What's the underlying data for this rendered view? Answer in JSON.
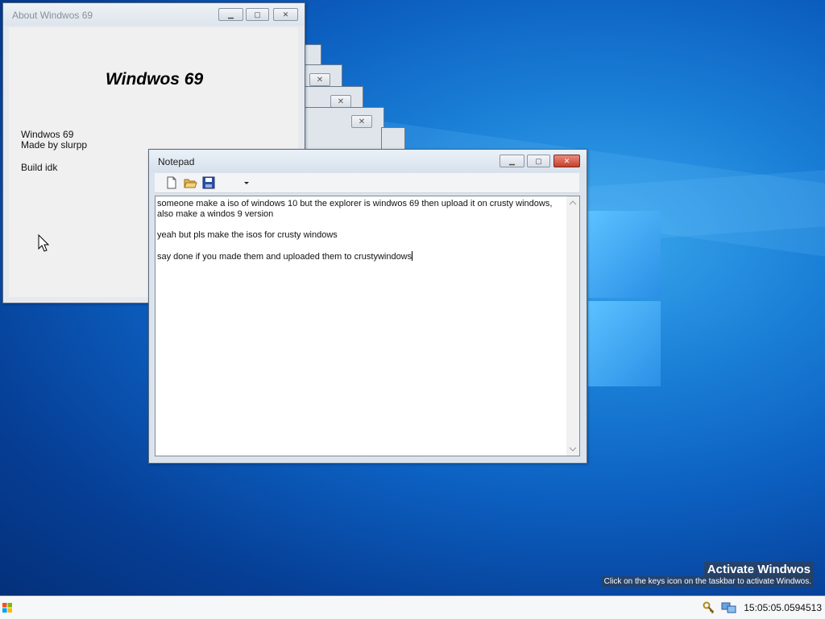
{
  "about_window": {
    "title": "About Windwos 69",
    "heading": "Windwos 69",
    "lines": [
      "Windwos 69",
      "Made by slurpp",
      "Build idk"
    ]
  },
  "notepad": {
    "title": "Notepad",
    "paragraphs": [
      "someone make a iso of windows 10 but the explorer is windwos 69 then upload it on crusty windows, also make a windos 9 version",
      "yeah but pls make the isos for crusty windows",
      "say done if you made them and uploaded them to crustywindows"
    ],
    "toolbar": [
      "new-file-icon",
      "open-folder-icon",
      "save-icon",
      "dropdown-arrow-icon"
    ]
  },
  "watermark": {
    "title": "Activate Windwos",
    "subtitle": "Click on the keys icon on the taskbar to activate Windwos."
  },
  "taskbar": {
    "clock": "15:05:05.0594513",
    "tray_icons": [
      "keys-icon",
      "network-icon"
    ]
  },
  "colors": {
    "desktop_accent": "#1a7fd6",
    "close_button": "#c6402b"
  }
}
